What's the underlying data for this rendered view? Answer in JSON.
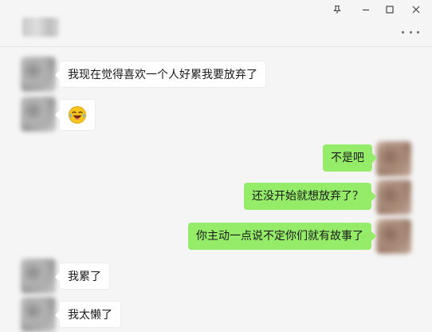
{
  "window": {
    "controls": [
      "pin-icon",
      "minimize-icon",
      "maximize-icon",
      "close-icon"
    ]
  },
  "header": {
    "more_icon": "more-icon"
  },
  "messages": [
    {
      "side": "left",
      "text": "我现在觉得喜欢一个人好累我要放弃了"
    },
    {
      "side": "left",
      "emoji": "laughing-crying-emoji"
    },
    {
      "side": "right",
      "text": "不是吧"
    },
    {
      "side": "right",
      "text": "还没开始就想放弃了？"
    },
    {
      "side": "right",
      "text": "你主动一点说不定你们就有故事了"
    },
    {
      "side": "left",
      "text": "我累了"
    },
    {
      "side": "left",
      "text": "我太懒了"
    }
  ],
  "colors": {
    "sent_bubble": "#95ec69",
    "received_bubble": "#ffffff",
    "background": "#f5f5f5"
  }
}
